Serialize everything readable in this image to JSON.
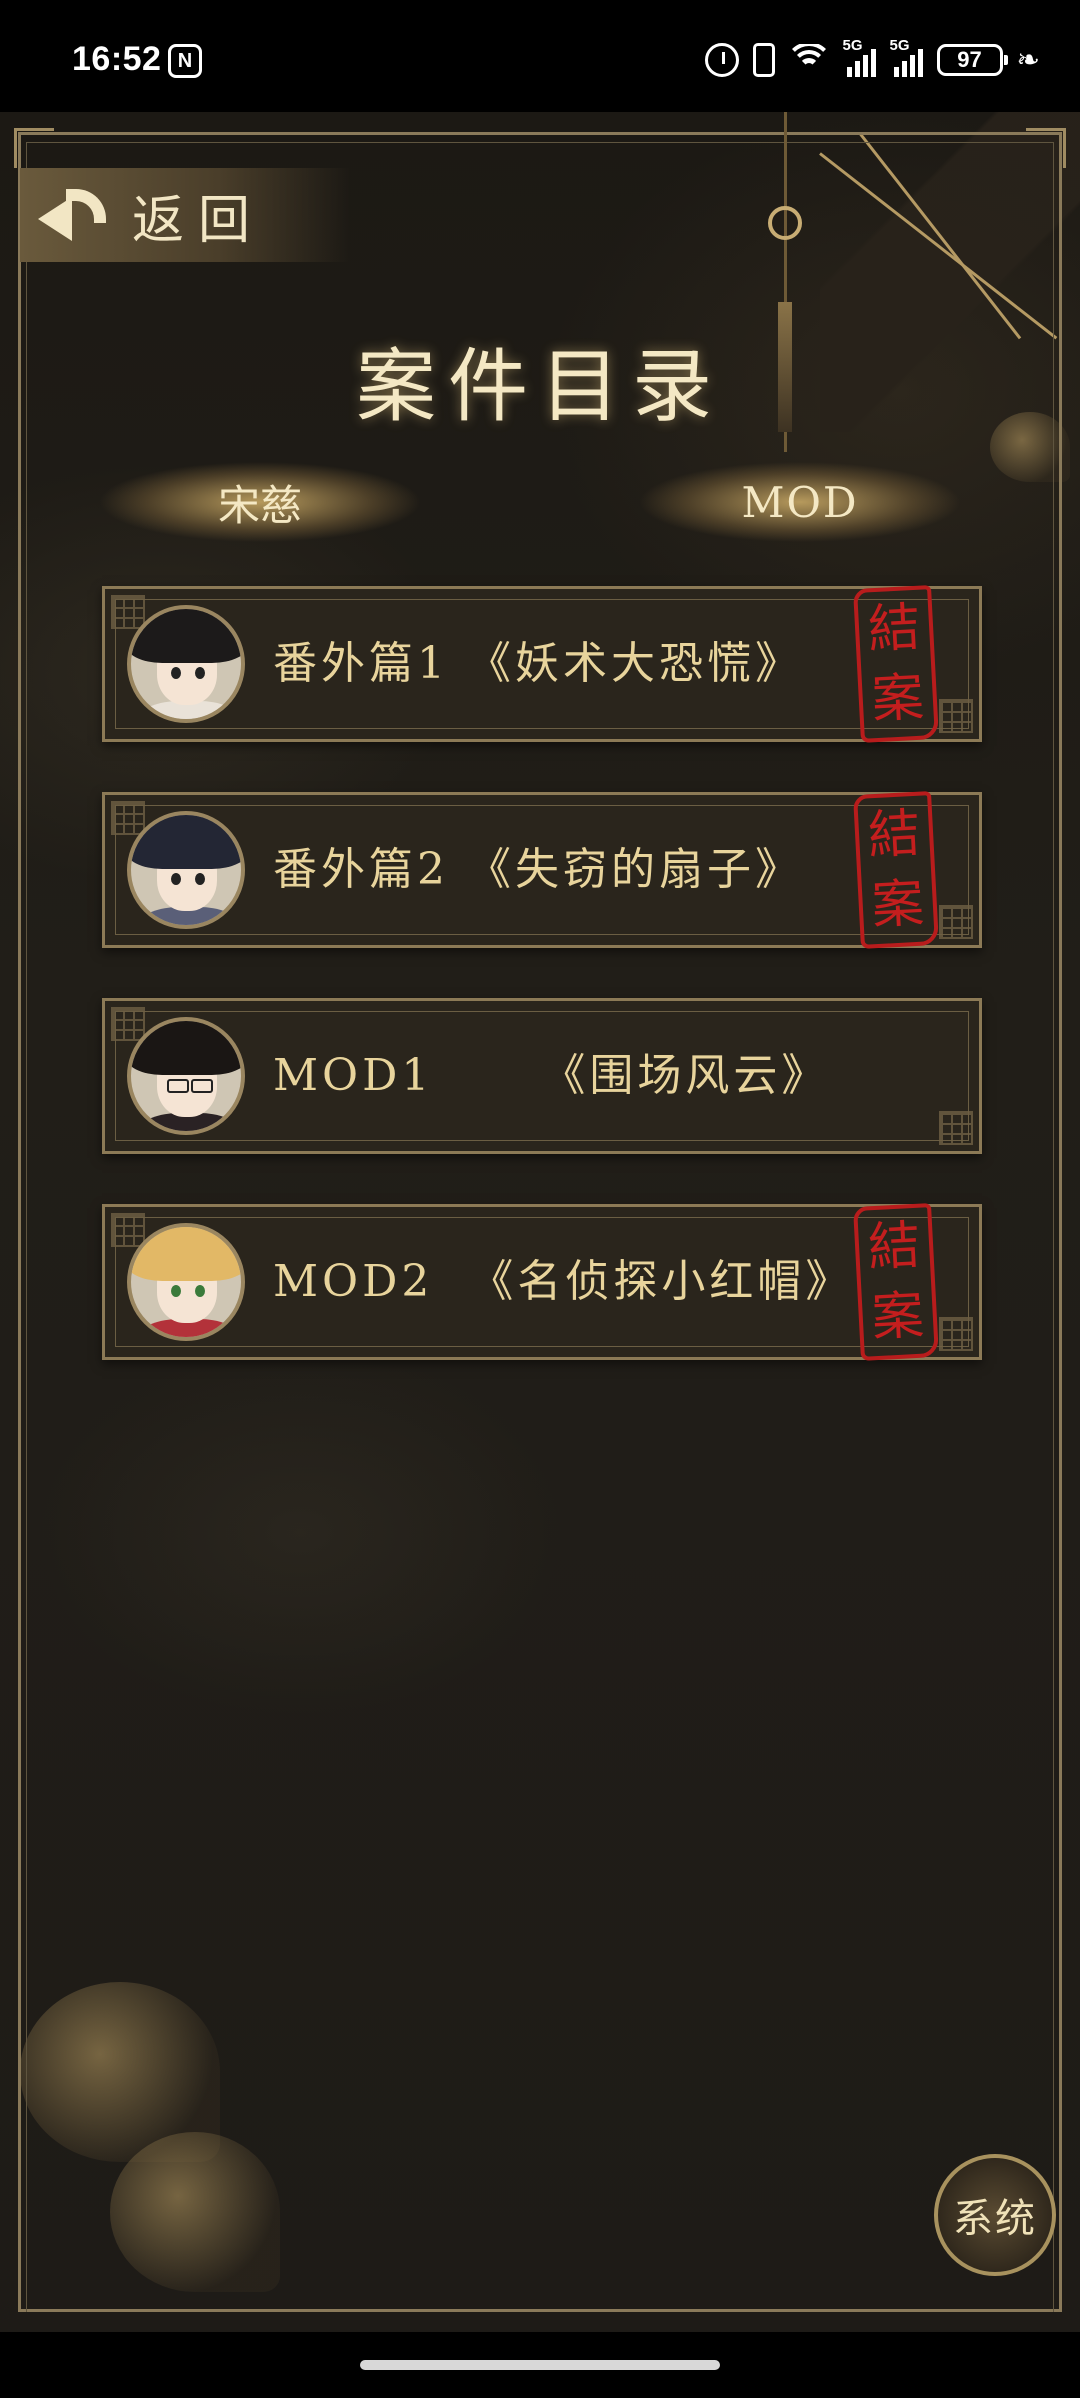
{
  "status_bar": {
    "time": "16:52",
    "nfc_label": "N",
    "net1": "5G",
    "net2": "5G",
    "battery": "97"
  },
  "header": {
    "back_label": "返回",
    "title": "案件目录"
  },
  "tabs": [
    {
      "label": "宋慈"
    },
    {
      "label": "MOD"
    }
  ],
  "cases": [
    {
      "title": "番外篇1 《妖术大恐慌》",
      "closed": true,
      "stamp": [
        "結",
        "案"
      ],
      "avatar": {
        "hair": "#1c1a1a",
        "body": "#e9e2d8"
      }
    },
    {
      "title": "番外篇2 《失窃的扇子》",
      "closed": true,
      "stamp": [
        "結",
        "案"
      ],
      "avatar": {
        "hair": "#232634",
        "body": "#5a5f78"
      }
    },
    {
      "title": "MOD1      《围场风云》",
      "closed": false,
      "stamp": [],
      "avatar": {
        "hair": "#1a1614",
        "body": "#2a2224"
      }
    },
    {
      "title": "MOD2  《名侦探小红帽》",
      "closed": true,
      "stamp": [
        "結",
        "案"
      ],
      "avatar": {
        "hair": "#e2b866",
        "body": "#b3323a"
      }
    }
  ],
  "system_button": {
    "label": "系统"
  },
  "colors": {
    "accent": "#e8d49c",
    "stamp": "#c41e1e",
    "frame": "#8c7a56"
  }
}
